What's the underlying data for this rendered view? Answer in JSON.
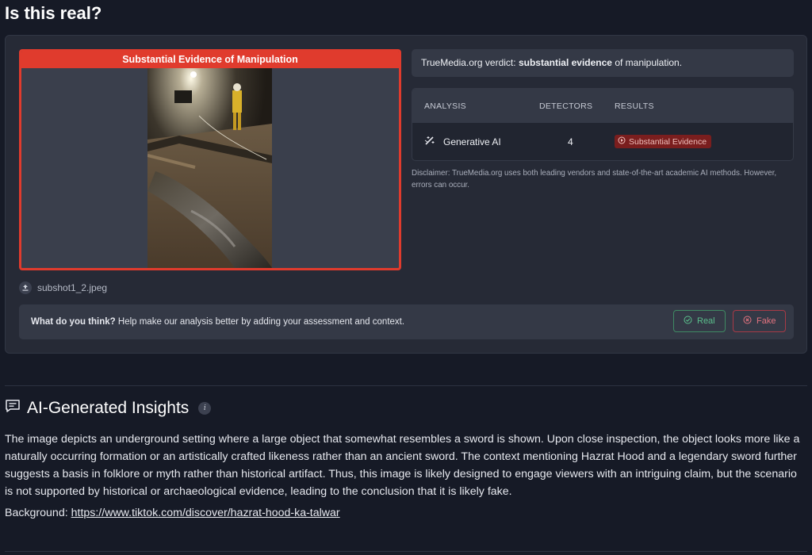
{
  "page": {
    "title": "Is this real?"
  },
  "media": {
    "banner": "Substantial Evidence of Manipulation",
    "filename": "subshot1_2.jpeg"
  },
  "verdict": {
    "prefix": "TrueMedia.org verdict: ",
    "emphasis": "substantial evidence",
    "suffix": " of manipulation."
  },
  "analysis": {
    "headers": {
      "analysis": "ANALYSIS",
      "detectors": "DETECTORS",
      "results": "RESULTS"
    },
    "rows": [
      {
        "name": "Generative AI",
        "detectors": "4",
        "result": "Substantial Evidence",
        "icon": "magic-wand-icon"
      }
    ],
    "disclaimer": "Disclaimer: TrueMedia.org uses both leading vendors and state-of-the-art academic AI methods. However, errors can occur."
  },
  "feedback": {
    "question": "What do you think?",
    "prompt": " Help make our analysis better by adding your assessment and context.",
    "real_label": "Real",
    "fake_label": "Fake"
  },
  "insights": {
    "title": "AI-Generated Insights",
    "info_glyph": "i",
    "body": "The image depicts an underground setting where a large object that somewhat resembles a sword is shown. Upon close inspection, the object looks more like a naturally occurring formation or an artistically crafted likeness rather than an ancient sword. The context mentioning Hazrat Hood and a legendary sword further suggests a basis in folklore or myth rather than historical artifact. Thus, this image is likely designed to engage viewers with an intriguing claim, but the scenario is not supported by historical or archaeological evidence, leading to the conclusion that it is likely fake.",
    "background_label": "Background: ",
    "background_link": "https://www.tiktok.com/discover/hazrat-hood-ka-talwar"
  },
  "colors": {
    "manipulation_red": "#e03b2d",
    "real_green": "#5bbf8c",
    "fake_red": "#e2737f",
    "badge_red": "#7a1e1e"
  }
}
